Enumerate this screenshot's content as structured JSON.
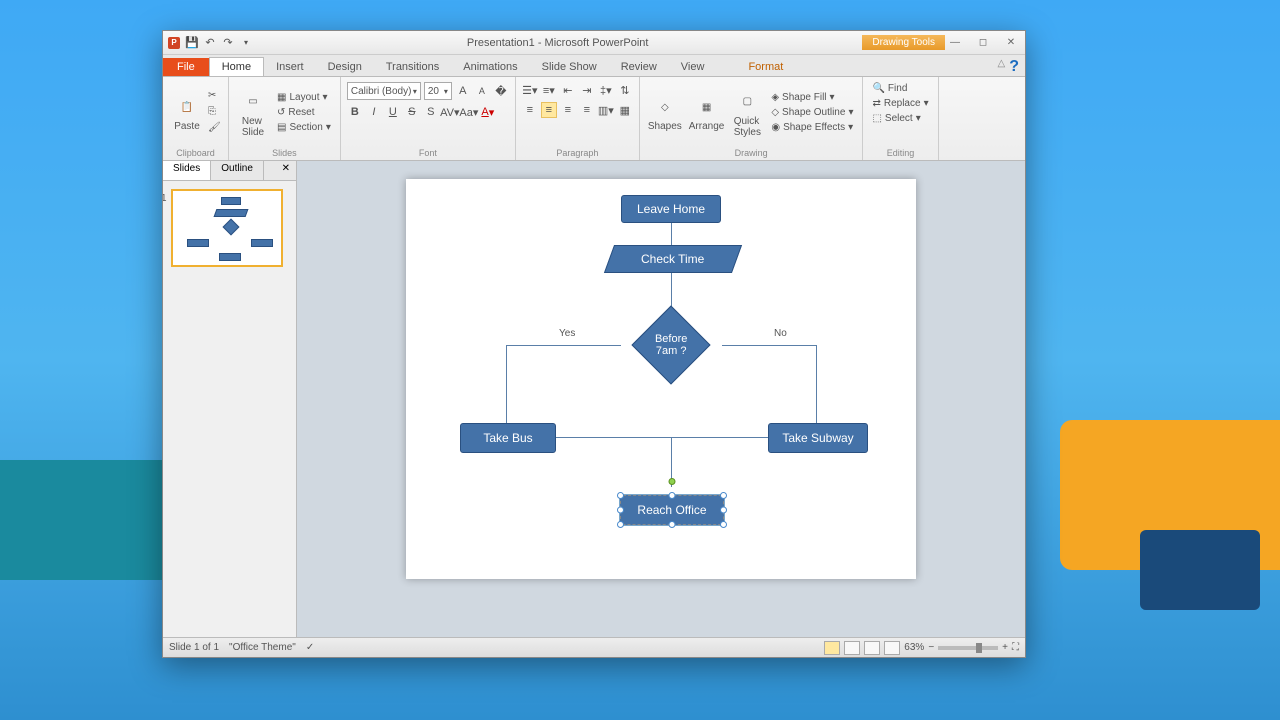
{
  "window": {
    "title": "Presentation1 - Microsoft PowerPoint",
    "contextual_tab": "Drawing Tools"
  },
  "tabs": {
    "file": "File",
    "home": "Home",
    "insert": "Insert",
    "design": "Design",
    "transitions": "Transitions",
    "animations": "Animations",
    "slideshow": "Slide Show",
    "review": "Review",
    "view": "View",
    "format": "Format"
  },
  "ribbon": {
    "clipboard": {
      "label": "Clipboard",
      "paste": "Paste"
    },
    "slides": {
      "label": "Slides",
      "new_slide": "New\nSlide",
      "layout": "Layout",
      "reset": "Reset",
      "section": "Section"
    },
    "font": {
      "label": "Font",
      "name": "Calibri (Body)",
      "size": "20"
    },
    "paragraph": {
      "label": "Paragraph"
    },
    "drawing": {
      "label": "Drawing",
      "shapes": "Shapes",
      "arrange": "Arrange",
      "quick_styles": "Quick\nStyles",
      "shape_fill": "Shape Fill",
      "shape_outline": "Shape Outline",
      "shape_effects": "Shape Effects"
    },
    "editing": {
      "label": "Editing",
      "find": "Find",
      "replace": "Replace",
      "select": "Select"
    }
  },
  "side_panel": {
    "slides_tab": "Slides",
    "outline_tab": "Outline",
    "thumb_num": "1"
  },
  "flowchart": {
    "leave_home": "Leave Home",
    "check_time": "Check Time",
    "decision": "Before\n7am ?",
    "yes": "Yes",
    "no": "No",
    "take_bus": "Take Bus",
    "take_subway": "Take Subway",
    "reach_office": "Reach Office"
  },
  "statusbar": {
    "slide_info": "Slide 1 of 1",
    "theme": "\"Office Theme\"",
    "zoom": "63%"
  }
}
